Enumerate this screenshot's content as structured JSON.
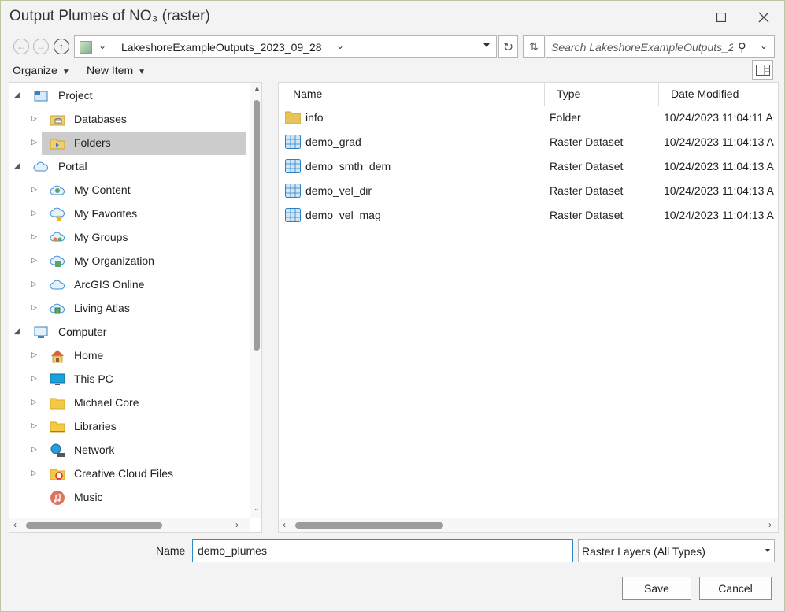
{
  "window": {
    "title": "Output Plumes of NO₃ (raster)"
  },
  "address": {
    "location": "LakeshoreExampleOutputs_2023_09_28"
  },
  "search": {
    "placeholder": "Search LakeshoreExampleOutputs_2"
  },
  "menu": {
    "organize": "Organize",
    "new_item": "New Item"
  },
  "tree": {
    "project": "Project",
    "databases": "Databases",
    "folders": "Folders",
    "portal": "Portal",
    "my_content": "My Content",
    "my_favorites": "My Favorites",
    "my_groups": "My Groups",
    "my_organization": "My Organization",
    "arcgis_online": "ArcGIS Online",
    "living_atlas": "Living Atlas",
    "computer": "Computer",
    "home": "Home",
    "this_pc": "This PC",
    "michael_core": "Michael Core",
    "libraries": "Libraries",
    "network": "Network",
    "creative_cloud": "Creative Cloud Files",
    "music": "Music"
  },
  "columns": {
    "name": "Name",
    "type": "Type",
    "date": "Date Modified"
  },
  "files": [
    {
      "name": "info",
      "type": "Folder",
      "date": "10/24/2023 11:04:11 A"
    },
    {
      "name": "demo_grad",
      "type": "Raster Dataset",
      "date": "10/24/2023 11:04:13 A"
    },
    {
      "name": "demo_smth_dem",
      "type": "Raster Dataset",
      "date": "10/24/2023 11:04:13 A"
    },
    {
      "name": "demo_vel_dir",
      "type": "Raster Dataset",
      "date": "10/24/2023 11:04:13 A"
    },
    {
      "name": "demo_vel_mag",
      "type": "Raster Dataset",
      "date": "10/24/2023 11:04:13 A"
    }
  ],
  "bottom": {
    "name_label": "Name",
    "name_value": "demo_plumes",
    "type_filter": "Raster Layers (All Types)",
    "save": "Save",
    "cancel": "Cancel"
  }
}
